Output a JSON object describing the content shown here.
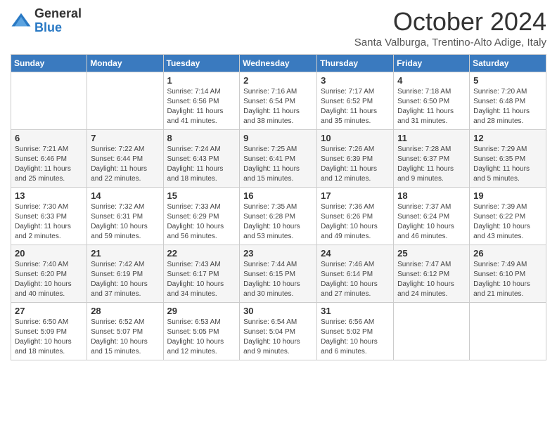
{
  "logo": {
    "general": "General",
    "blue": "Blue"
  },
  "title": {
    "month": "October 2024",
    "location": "Santa Valburga, Trentino-Alto Adige, Italy"
  },
  "days_of_week": [
    "Sunday",
    "Monday",
    "Tuesday",
    "Wednesday",
    "Thursday",
    "Friday",
    "Saturday"
  ],
  "weeks": [
    [
      {
        "day": "",
        "sunrise": "",
        "sunset": "",
        "daylight": ""
      },
      {
        "day": "",
        "sunrise": "",
        "sunset": "",
        "daylight": ""
      },
      {
        "day": "1",
        "sunrise": "Sunrise: 7:14 AM",
        "sunset": "Sunset: 6:56 PM",
        "daylight": "Daylight: 11 hours and 41 minutes."
      },
      {
        "day": "2",
        "sunrise": "Sunrise: 7:16 AM",
        "sunset": "Sunset: 6:54 PM",
        "daylight": "Daylight: 11 hours and 38 minutes."
      },
      {
        "day": "3",
        "sunrise": "Sunrise: 7:17 AM",
        "sunset": "Sunset: 6:52 PM",
        "daylight": "Daylight: 11 hours and 35 minutes."
      },
      {
        "day": "4",
        "sunrise": "Sunrise: 7:18 AM",
        "sunset": "Sunset: 6:50 PM",
        "daylight": "Daylight: 11 hours and 31 minutes."
      },
      {
        "day": "5",
        "sunrise": "Sunrise: 7:20 AM",
        "sunset": "Sunset: 6:48 PM",
        "daylight": "Daylight: 11 hours and 28 minutes."
      }
    ],
    [
      {
        "day": "6",
        "sunrise": "Sunrise: 7:21 AM",
        "sunset": "Sunset: 6:46 PM",
        "daylight": "Daylight: 11 hours and 25 minutes."
      },
      {
        "day": "7",
        "sunrise": "Sunrise: 7:22 AM",
        "sunset": "Sunset: 6:44 PM",
        "daylight": "Daylight: 11 hours and 22 minutes."
      },
      {
        "day": "8",
        "sunrise": "Sunrise: 7:24 AM",
        "sunset": "Sunset: 6:43 PM",
        "daylight": "Daylight: 11 hours and 18 minutes."
      },
      {
        "day": "9",
        "sunrise": "Sunrise: 7:25 AM",
        "sunset": "Sunset: 6:41 PM",
        "daylight": "Daylight: 11 hours and 15 minutes."
      },
      {
        "day": "10",
        "sunrise": "Sunrise: 7:26 AM",
        "sunset": "Sunset: 6:39 PM",
        "daylight": "Daylight: 11 hours and 12 minutes."
      },
      {
        "day": "11",
        "sunrise": "Sunrise: 7:28 AM",
        "sunset": "Sunset: 6:37 PM",
        "daylight": "Daylight: 11 hours and 9 minutes."
      },
      {
        "day": "12",
        "sunrise": "Sunrise: 7:29 AM",
        "sunset": "Sunset: 6:35 PM",
        "daylight": "Daylight: 11 hours and 5 minutes."
      }
    ],
    [
      {
        "day": "13",
        "sunrise": "Sunrise: 7:30 AM",
        "sunset": "Sunset: 6:33 PM",
        "daylight": "Daylight: 11 hours and 2 minutes."
      },
      {
        "day": "14",
        "sunrise": "Sunrise: 7:32 AM",
        "sunset": "Sunset: 6:31 PM",
        "daylight": "Daylight: 10 hours and 59 minutes."
      },
      {
        "day": "15",
        "sunrise": "Sunrise: 7:33 AM",
        "sunset": "Sunset: 6:29 PM",
        "daylight": "Daylight: 10 hours and 56 minutes."
      },
      {
        "day": "16",
        "sunrise": "Sunrise: 7:35 AM",
        "sunset": "Sunset: 6:28 PM",
        "daylight": "Daylight: 10 hours and 53 minutes."
      },
      {
        "day": "17",
        "sunrise": "Sunrise: 7:36 AM",
        "sunset": "Sunset: 6:26 PM",
        "daylight": "Daylight: 10 hours and 49 minutes."
      },
      {
        "day": "18",
        "sunrise": "Sunrise: 7:37 AM",
        "sunset": "Sunset: 6:24 PM",
        "daylight": "Daylight: 10 hours and 46 minutes."
      },
      {
        "day": "19",
        "sunrise": "Sunrise: 7:39 AM",
        "sunset": "Sunset: 6:22 PM",
        "daylight": "Daylight: 10 hours and 43 minutes."
      }
    ],
    [
      {
        "day": "20",
        "sunrise": "Sunrise: 7:40 AM",
        "sunset": "Sunset: 6:20 PM",
        "daylight": "Daylight: 10 hours and 40 minutes."
      },
      {
        "day": "21",
        "sunrise": "Sunrise: 7:42 AM",
        "sunset": "Sunset: 6:19 PM",
        "daylight": "Daylight: 10 hours and 37 minutes."
      },
      {
        "day": "22",
        "sunrise": "Sunrise: 7:43 AM",
        "sunset": "Sunset: 6:17 PM",
        "daylight": "Daylight: 10 hours and 34 minutes."
      },
      {
        "day": "23",
        "sunrise": "Sunrise: 7:44 AM",
        "sunset": "Sunset: 6:15 PM",
        "daylight": "Daylight: 10 hours and 30 minutes."
      },
      {
        "day": "24",
        "sunrise": "Sunrise: 7:46 AM",
        "sunset": "Sunset: 6:14 PM",
        "daylight": "Daylight: 10 hours and 27 minutes."
      },
      {
        "day": "25",
        "sunrise": "Sunrise: 7:47 AM",
        "sunset": "Sunset: 6:12 PM",
        "daylight": "Daylight: 10 hours and 24 minutes."
      },
      {
        "day": "26",
        "sunrise": "Sunrise: 7:49 AM",
        "sunset": "Sunset: 6:10 PM",
        "daylight": "Daylight: 10 hours and 21 minutes."
      }
    ],
    [
      {
        "day": "27",
        "sunrise": "Sunrise: 6:50 AM",
        "sunset": "Sunset: 5:09 PM",
        "daylight": "Daylight: 10 hours and 18 minutes."
      },
      {
        "day": "28",
        "sunrise": "Sunrise: 6:52 AM",
        "sunset": "Sunset: 5:07 PM",
        "daylight": "Daylight: 10 hours and 15 minutes."
      },
      {
        "day": "29",
        "sunrise": "Sunrise: 6:53 AM",
        "sunset": "Sunset: 5:05 PM",
        "daylight": "Daylight: 10 hours and 12 minutes."
      },
      {
        "day": "30",
        "sunrise": "Sunrise: 6:54 AM",
        "sunset": "Sunset: 5:04 PM",
        "daylight": "Daylight: 10 hours and 9 minutes."
      },
      {
        "day": "31",
        "sunrise": "Sunrise: 6:56 AM",
        "sunset": "Sunset: 5:02 PM",
        "daylight": "Daylight: 10 hours and 6 minutes."
      },
      {
        "day": "",
        "sunrise": "",
        "sunset": "",
        "daylight": ""
      },
      {
        "day": "",
        "sunrise": "",
        "sunset": "",
        "daylight": ""
      }
    ]
  ]
}
